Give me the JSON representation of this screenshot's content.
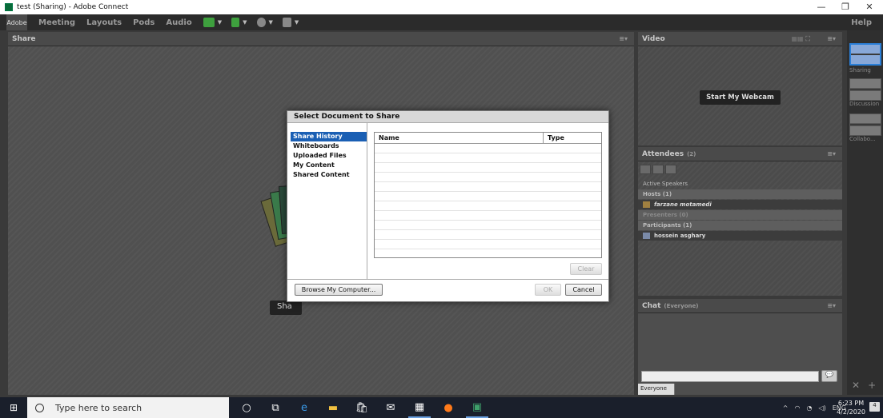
{
  "window": {
    "title": "test (Sharing) - Adobe Connect",
    "minimize": "—",
    "restore": "❐",
    "close": "✕"
  },
  "menu": {
    "logo": "Adobe",
    "items": [
      "Meeting",
      "Layouts",
      "Pods",
      "Audio"
    ],
    "help": "Help"
  },
  "share_pod": {
    "title": "Share",
    "share_button_partial": "Sha"
  },
  "dialog": {
    "title": "Select Document to Share",
    "nav": [
      "Share History",
      "Whiteboards",
      "Uploaded Files",
      "My Content",
      "Shared Content"
    ],
    "selected_nav": "Share History",
    "columns": [
      "Name",
      "Type"
    ],
    "clear": "Clear",
    "browse": "Browse My Computer...",
    "ok": "OK",
    "cancel": "Cancel"
  },
  "video_pod": {
    "title": "Video",
    "start_webcam": "Start My Webcam"
  },
  "attendees_pod": {
    "title": "Attendees",
    "count": "(2)",
    "active_speakers": "Active Speakers",
    "hosts": "Hosts (1)",
    "host_name": "farzane motamedi",
    "presenters": "Presenters (0)",
    "participants": "Participants (1)",
    "participant_name": "hossein asghary"
  },
  "chat_pod": {
    "title": "Chat",
    "scope": "(Everyone)",
    "tab": "Everyone"
  },
  "layouts_rail": [
    "Sharing",
    "Discussion",
    "Collabo..."
  ],
  "taskbar": {
    "search_placeholder": "Type here to search",
    "language": "ENG",
    "time": "6:23 PM",
    "date": "4/2/2020",
    "notifications": "4"
  }
}
